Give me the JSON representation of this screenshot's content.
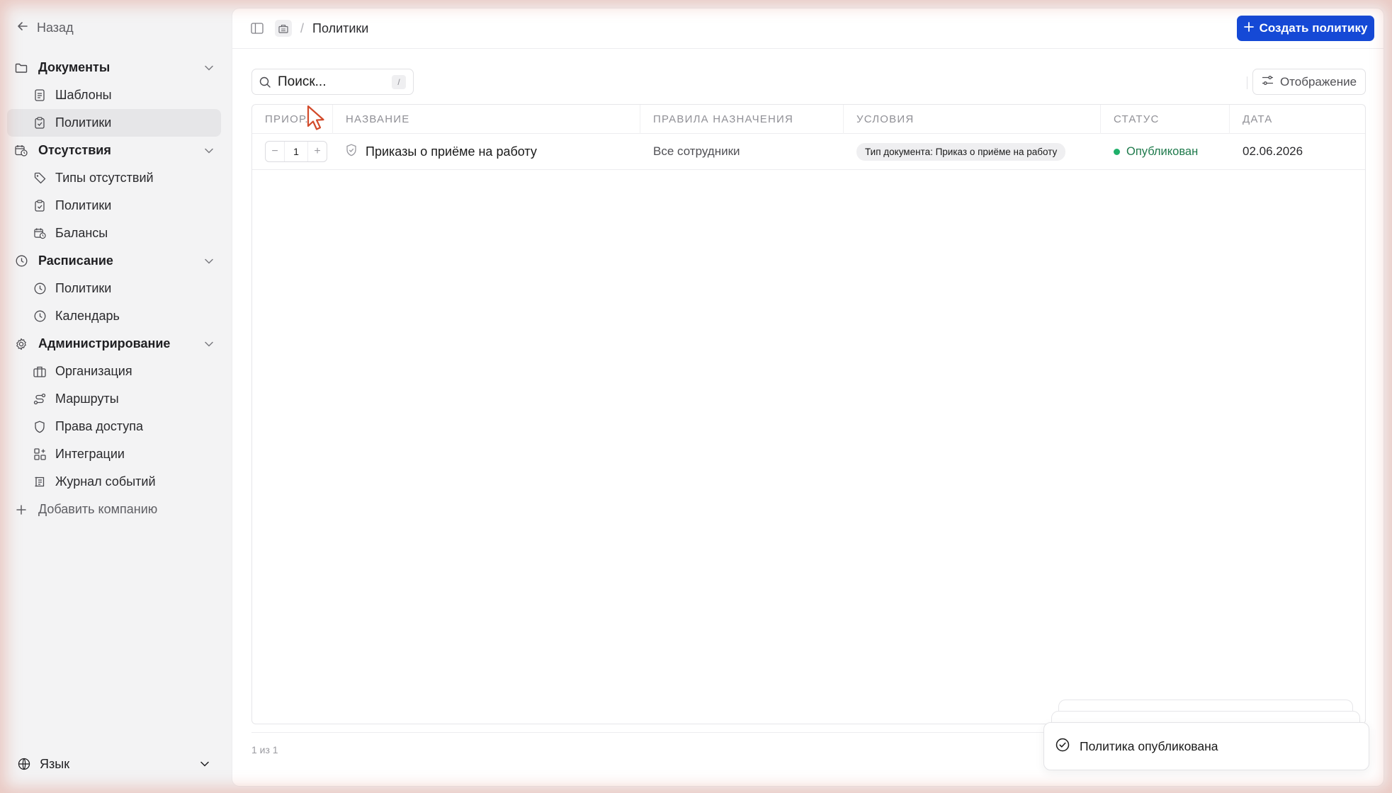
{
  "sidebar": {
    "back_label": "Назад",
    "groups": [
      {
        "label": "Документы",
        "icon": "folder-icon",
        "items": [
          {
            "label": "Шаблоны",
            "icon": "file-text-icon"
          },
          {
            "label": "Политики",
            "icon": "clipboard-check-icon",
            "active": true
          }
        ]
      },
      {
        "label": "Отсутствия",
        "icon": "calendar-clock-icon",
        "items": [
          {
            "label": "Типы отсутствий",
            "icon": "tag-icon"
          },
          {
            "label": "Политики",
            "icon": "clipboard-check-icon"
          },
          {
            "label": "Балансы",
            "icon": "calendar-clock-icon"
          }
        ]
      },
      {
        "label": "Расписание",
        "icon": "clock-icon",
        "items": [
          {
            "label": "Политики",
            "icon": "clock-icon"
          },
          {
            "label": "Календарь",
            "icon": "clock-icon"
          }
        ]
      },
      {
        "label": "Администрирование",
        "icon": "gear-icon",
        "items": [
          {
            "label": "Организация",
            "icon": "building-icon"
          },
          {
            "label": "Маршруты",
            "icon": "route-icon"
          },
          {
            "label": "Права доступа",
            "icon": "shield-icon"
          },
          {
            "label": "Интеграции",
            "icon": "grid-plus-icon"
          },
          {
            "label": "Журнал событий",
            "icon": "log-icon"
          }
        ]
      }
    ],
    "add_company_label": "Добавить компанию",
    "language_label": "Язык"
  },
  "topbar": {
    "breadcrumb_title": "Политики",
    "create_button_label": "Создать политику"
  },
  "toolbar": {
    "search_placeholder": "Поиск...",
    "search_shortcut": "/",
    "display_button_label": "Отображение"
  },
  "table": {
    "columns": [
      "ПРИОР...",
      "НАЗВАНИЕ",
      "ПРАВИЛА НАЗНАЧЕНИЯ",
      "УСЛОВИЯ",
      "СТАТУС",
      "ДАТА"
    ],
    "rows": [
      {
        "priority": "1",
        "name": "Приказы о приёме на работу",
        "assignment": "Все сотрудники",
        "condition": "Тип документа: Приказ о приёме на работу",
        "status": "Опубликован",
        "date": "02.06.2026"
      }
    ],
    "footer_count": "1 из 1"
  },
  "toast": {
    "message": "Политика опубликована"
  },
  "colors": {
    "accent": "#1549d6",
    "status_published": "#1fb06a"
  }
}
